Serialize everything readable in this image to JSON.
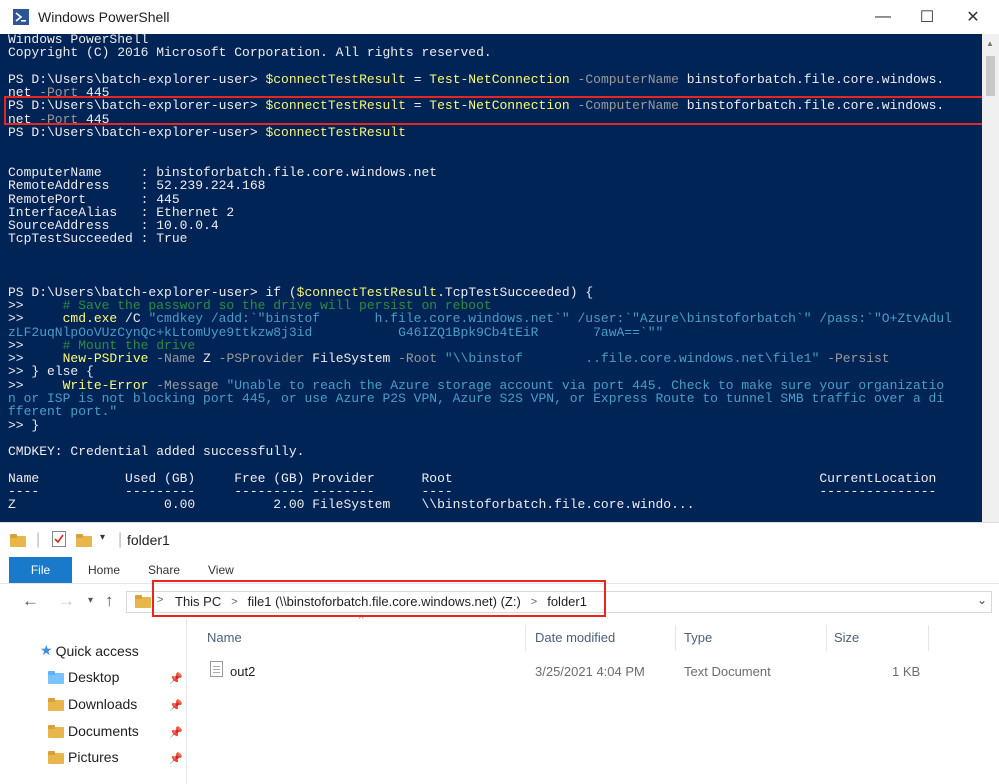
{
  "powershell": {
    "title": "Windows PowerShell",
    "window_controls": {
      "minimize": "—",
      "maximize": "☐",
      "close": "✕"
    },
    "lines": [
      [
        {
          "t": "Windows PowerShell",
          "c": "w"
        }
      ],
      [
        {
          "t": "Copyright (C) 2016 Microsoft Corporation. All rights reserved.",
          "c": "w"
        }
      ],
      [
        {
          "t": "",
          "c": "w"
        }
      ],
      [
        {
          "t": "PS D:\\Users\\batch-explorer-user> ",
          "c": "w"
        },
        {
          "t": "$connectTestResult",
          "c": "var"
        },
        {
          "t": " = ",
          "c": "w"
        },
        {
          "t": "Test-NetConnection",
          "c": "cmd"
        },
        {
          "t": " -ComputerName",
          "c": "par"
        },
        {
          "t": " binstoforbatch.file.core.windows.",
          "c": "w"
        }
      ],
      [
        {
          "t": "net",
          "c": "w"
        },
        {
          "t": " -Port",
          "c": "par"
        },
        {
          "t": " 445",
          "c": "w"
        }
      ],
      [
        {
          "t": "PS D:\\Users\\batch-explorer-user> ",
          "c": "w"
        },
        {
          "t": "$connectTestResult",
          "c": "var"
        },
        {
          "t": " = ",
          "c": "w"
        },
        {
          "t": "Test-NetConnection",
          "c": "cmd"
        },
        {
          "t": " -ComputerName",
          "c": "par"
        },
        {
          "t": " binstoforbatch.file.core.windows.",
          "c": "w"
        }
      ],
      [
        {
          "t": "net",
          "c": "w"
        },
        {
          "t": " -Port",
          "c": "par"
        },
        {
          "t": " 445",
          "c": "w"
        }
      ],
      [
        {
          "t": "PS D:\\Users\\batch-explorer-user> ",
          "c": "w"
        },
        {
          "t": "$connectTestResult",
          "c": "var"
        }
      ],
      [
        {
          "t": "",
          "c": "w"
        }
      ],
      [
        {
          "t": "",
          "c": "w"
        }
      ],
      [
        {
          "t": "ComputerName     : binstoforbatch.file.core.windows.net",
          "c": "w"
        }
      ],
      [
        {
          "t": "RemoteAddress    : 52.239.224.168",
          "c": "w"
        }
      ],
      [
        {
          "t": "RemotePort       : 445",
          "c": "w"
        }
      ],
      [
        {
          "t": "InterfaceAlias   : Ethernet 2",
          "c": "w"
        }
      ],
      [
        {
          "t": "SourceAddress    : 10.0.0.4",
          "c": "w"
        }
      ],
      [
        {
          "t": "TcpTestSucceeded : True",
          "c": "w"
        }
      ],
      [
        {
          "t": "",
          "c": "w"
        }
      ],
      [
        {
          "t": "",
          "c": "w"
        }
      ],
      [
        {
          "t": "",
          "c": "w"
        }
      ],
      [
        {
          "t": "PS D:\\Users\\batch-explorer-user> ",
          "c": "w"
        },
        {
          "t": "if",
          "c": "w"
        },
        {
          "t": " (",
          "c": "w"
        },
        {
          "t": "$connectTestResult",
          "c": "var"
        },
        {
          "t": ".TcpTestSucceeded) {",
          "c": "w"
        }
      ],
      [
        {
          "t": ">>     ",
          "c": "w"
        },
        {
          "t": "# Save the password so the drive will persist on reboot",
          "c": "com"
        }
      ],
      [
        {
          "t": ">>     ",
          "c": "w"
        },
        {
          "t": "cmd.exe",
          "c": "cmd"
        },
        {
          "t": " /C ",
          "c": "w"
        },
        {
          "t": "\"cmdkey /add:`\"binstof       h.file.core.windows.net`\" /user:`\"Azure\\binstoforbatch`\" /pass:`\"O+ZtvAdul",
          "c": "str"
        }
      ],
      [
        {
          "t": "zLF2uqNlpOoVUzCynQc+kLtomUye9ttkzw8j3id           G46IZQ1Bpk9Cb4tEiR       7awA==`\"\"",
          "c": "str"
        }
      ],
      [
        {
          "t": ">>     ",
          "c": "w"
        },
        {
          "t": "# Mount the drive",
          "c": "com"
        }
      ],
      [
        {
          "t": ">>     ",
          "c": "w"
        },
        {
          "t": "New-PSDrive",
          "c": "cmd"
        },
        {
          "t": " -Name",
          "c": "par"
        },
        {
          "t": " Z ",
          "c": "w"
        },
        {
          "t": "-PSProvider",
          "c": "par"
        },
        {
          "t": " FileSystem ",
          "c": "w"
        },
        {
          "t": "-Root",
          "c": "par"
        },
        {
          "t": " \"\\\\binstof        ..file.core.windows.net\\file1\"",
          "c": "str"
        },
        {
          "t": " -Persist",
          "c": "par"
        }
      ],
      [
        {
          "t": ">> } ",
          "c": "w"
        },
        {
          "t": "else",
          "c": "w"
        },
        {
          "t": " {",
          "c": "w"
        }
      ],
      [
        {
          "t": ">>     ",
          "c": "w"
        },
        {
          "t": "Write-Error",
          "c": "cmd"
        },
        {
          "t": " -Message",
          "c": "par"
        },
        {
          "t": " \"Unable to reach the Azure storage account via port 445. Check to make sure your organizatio",
          "c": "str"
        }
      ],
      [
        {
          "t": "n or ISP is not blocking port 445, or use Azure P2S VPN, Azure S2S VPN, or Express Route to tunnel SMB traffic over a di",
          "c": "str"
        }
      ],
      [
        {
          "t": "fferent port.\"",
          "c": "str"
        }
      ],
      [
        {
          "t": ">> }",
          "c": "w"
        }
      ],
      [
        {
          "t": "",
          "c": "w"
        }
      ],
      [
        {
          "t": "CMDKEY: Credential added successfully.",
          "c": "w"
        }
      ],
      [
        {
          "t": "",
          "c": "w"
        }
      ],
      [
        {
          "t": "Name           Used (GB)     Free (GB) Provider      Root                                               CurrentLocation",
          "c": "w"
        }
      ],
      [
        {
          "t": "----           ---------     --------- --------      ----                                               ---------------",
          "c": "w"
        }
      ],
      [
        {
          "t": "Z                   0.00          2.00 FileSystem    \\\\binstoforbatch.file.core.windo...",
          "c": "w"
        }
      ]
    ]
  },
  "explorer": {
    "title": "folder1",
    "quick_access_sep": "|",
    "ribbon": {
      "file": "File",
      "home": "Home",
      "share": "Share",
      "view": "View"
    },
    "address": {
      "crumbs": [
        "This PC",
        "file1 (\\\\binstoforbatch.file.core.windows.net) (Z:)",
        "folder1"
      ],
      "separator": ">"
    },
    "nav_pane": {
      "quick_access": "Quick access",
      "items": [
        "Desktop",
        "Downloads",
        "Documents",
        "Pictures"
      ]
    },
    "columns": {
      "name": "Name",
      "date": "Date modified",
      "type": "Type",
      "size": "Size"
    },
    "files": [
      {
        "name": "out2",
        "date": "3/25/2021 4:04 PM",
        "type": "Text Document",
        "size": "1 KB"
      }
    ]
  },
  "colors": {
    "console_bg": "#012456",
    "highlight": "#e8251f",
    "file_tab": "#1979ca"
  }
}
